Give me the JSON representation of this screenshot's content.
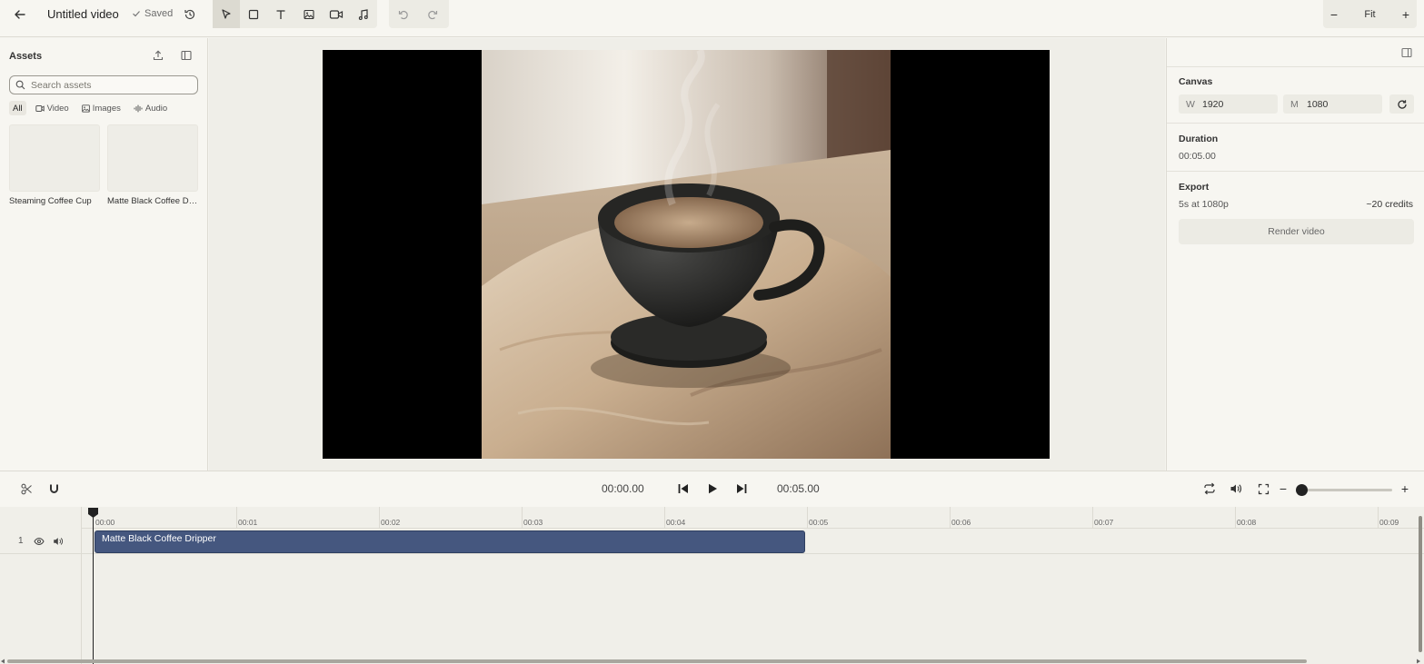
{
  "header": {
    "title": "Untitled video",
    "saved_label": "Saved",
    "zoom_label": "Fit"
  },
  "assets": {
    "title": "Assets",
    "search_placeholder": "Search assets",
    "filters": [
      {
        "label": "All",
        "icon": "none",
        "active": true
      },
      {
        "label": "Video",
        "icon": "video-icon",
        "active": false
      },
      {
        "label": "Images",
        "icon": "image-icon",
        "active": false
      },
      {
        "label": "Audio",
        "icon": "audio-icon",
        "active": false
      }
    ],
    "items": [
      {
        "name": "Steaming Coffee Cup"
      },
      {
        "name": "Matte Black Coffee Dripper"
      }
    ]
  },
  "properties": {
    "canvas_title": "Canvas",
    "width_label": "W",
    "width_value": "1920",
    "height_label": "M",
    "height_value": "1080",
    "duration_title": "Duration",
    "duration_value": "00:05.00",
    "export_title": "Export",
    "export_desc": "5s at 1080p",
    "export_credits": "~20 credits",
    "render_label": "Render video"
  },
  "transport": {
    "current_time": "00:00.00",
    "total_time": "00:05.00",
    "zoom_level": 0.0
  },
  "timeline": {
    "ticks": [
      "00:00",
      "00:01",
      "00:02",
      "00:03",
      "00:04",
      "00:05",
      "00:06",
      "00:07",
      "00:08",
      "00:09"
    ],
    "track_number": "1",
    "clip_label": "Matte Black Coffee Dripper"
  },
  "colors": {
    "clip": "#45577f",
    "background": "#f5f4ef",
    "active_tool": "#dcdad1"
  }
}
